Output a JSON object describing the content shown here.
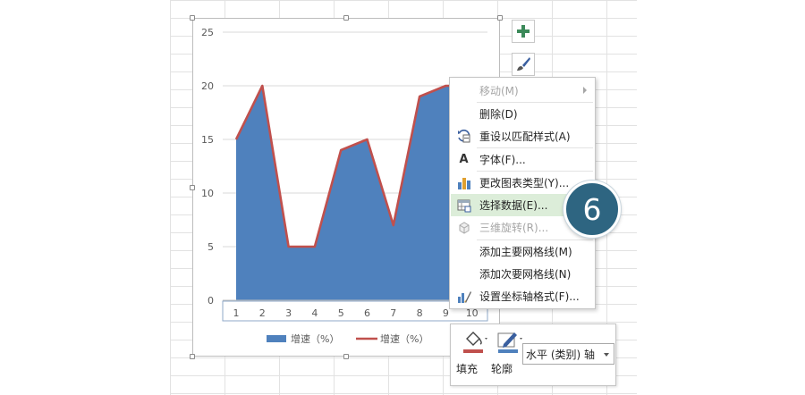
{
  "chart_data": {
    "type": "area",
    "x": [
      1,
      2,
      3,
      4,
      5,
      6,
      7,
      8,
      9,
      10
    ],
    "series": [
      {
        "name": "增速（%）",
        "kind": "area",
        "color": "#4f81bd",
        "values": [
          15,
          20,
          5,
          5,
          14,
          15,
          7,
          19,
          20,
          20
        ]
      },
      {
        "name": "增速（%）",
        "kind": "line",
        "color": "#c0504d",
        "values": [
          15,
          20,
          5,
          5,
          14,
          15,
          7,
          19,
          20,
          20
        ]
      }
    ],
    "ylim": [
      0,
      25
    ],
    "yticks": [
      "0",
      "5",
      "10",
      "15",
      "20",
      "25"
    ],
    "xticks": [
      "1",
      "2",
      "3",
      "4",
      "5",
      "6",
      "7",
      "8",
      "9",
      "10"
    ],
    "grid": true,
    "legend": "bottom"
  },
  "side_buttons": {
    "chart_elements_icon": "plus-icon",
    "chart_styles_icon": "brush-icon"
  },
  "context_menu": {
    "items": [
      {
        "label": "移动(M)",
        "icon": "",
        "disabled": true,
        "submenu": true
      },
      {
        "label": "删除(D)",
        "icon": ""
      },
      {
        "label": "重设以匹配样式(A)",
        "icon": "reset-style-icon"
      },
      {
        "label": "字体(F)...",
        "icon": "font-icon",
        "glyph": "A"
      },
      {
        "label": "更改图表类型(Y)...",
        "icon": "chart-type-icon"
      },
      {
        "label": "选择数据(E)...",
        "icon": "select-data-icon",
        "highlighted": true
      },
      {
        "label": "三维旋转(R)...",
        "icon": "3d-rotation-icon",
        "disabled": true
      },
      {
        "label": "添加主要网格线(M)",
        "icon": ""
      },
      {
        "label": "添加次要网格线(N)",
        "icon": ""
      },
      {
        "label": "设置坐标轴格式(F)...",
        "icon": "axis-format-icon"
      }
    ]
  },
  "step_badge": "6",
  "mini_toolbar": {
    "fill_label": "填充",
    "outline_label": "轮廓",
    "element_select": "水平 (类别) 轴",
    "fill_color": "#c0504d",
    "outline_color": "#4f81bd"
  }
}
